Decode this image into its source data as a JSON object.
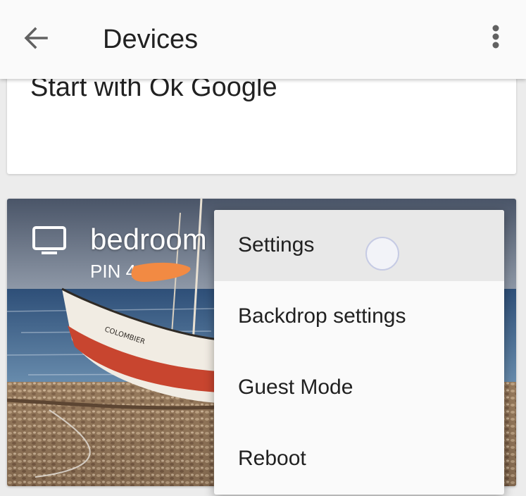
{
  "app_bar": {
    "title": "Devices",
    "back_icon": "arrow-left-icon",
    "overflow_icon": "more-vert-icon"
  },
  "top_card": {
    "text": "Start with Ok Google"
  },
  "device_card": {
    "device_icon": "tv-icon",
    "name": "bedroom",
    "pin_label": "PIN 4",
    "backdrop": "painting of a beached red and white boat named COLOMBIER on a pebble shore",
    "boat_name": "COLOMBIER"
  },
  "menu": {
    "items": [
      {
        "label": "Settings",
        "pressed": true
      },
      {
        "label": "Backdrop settings"
      },
      {
        "label": "Guest Mode"
      },
      {
        "label": "Reboot"
      }
    ]
  },
  "colors": {
    "app_bar_bg": "#fafafa",
    "text_primary": "#212121",
    "menu_bg": "#fafafa",
    "menu_pressed_bg": "#e8e8e8",
    "redaction": "#f28a43"
  }
}
